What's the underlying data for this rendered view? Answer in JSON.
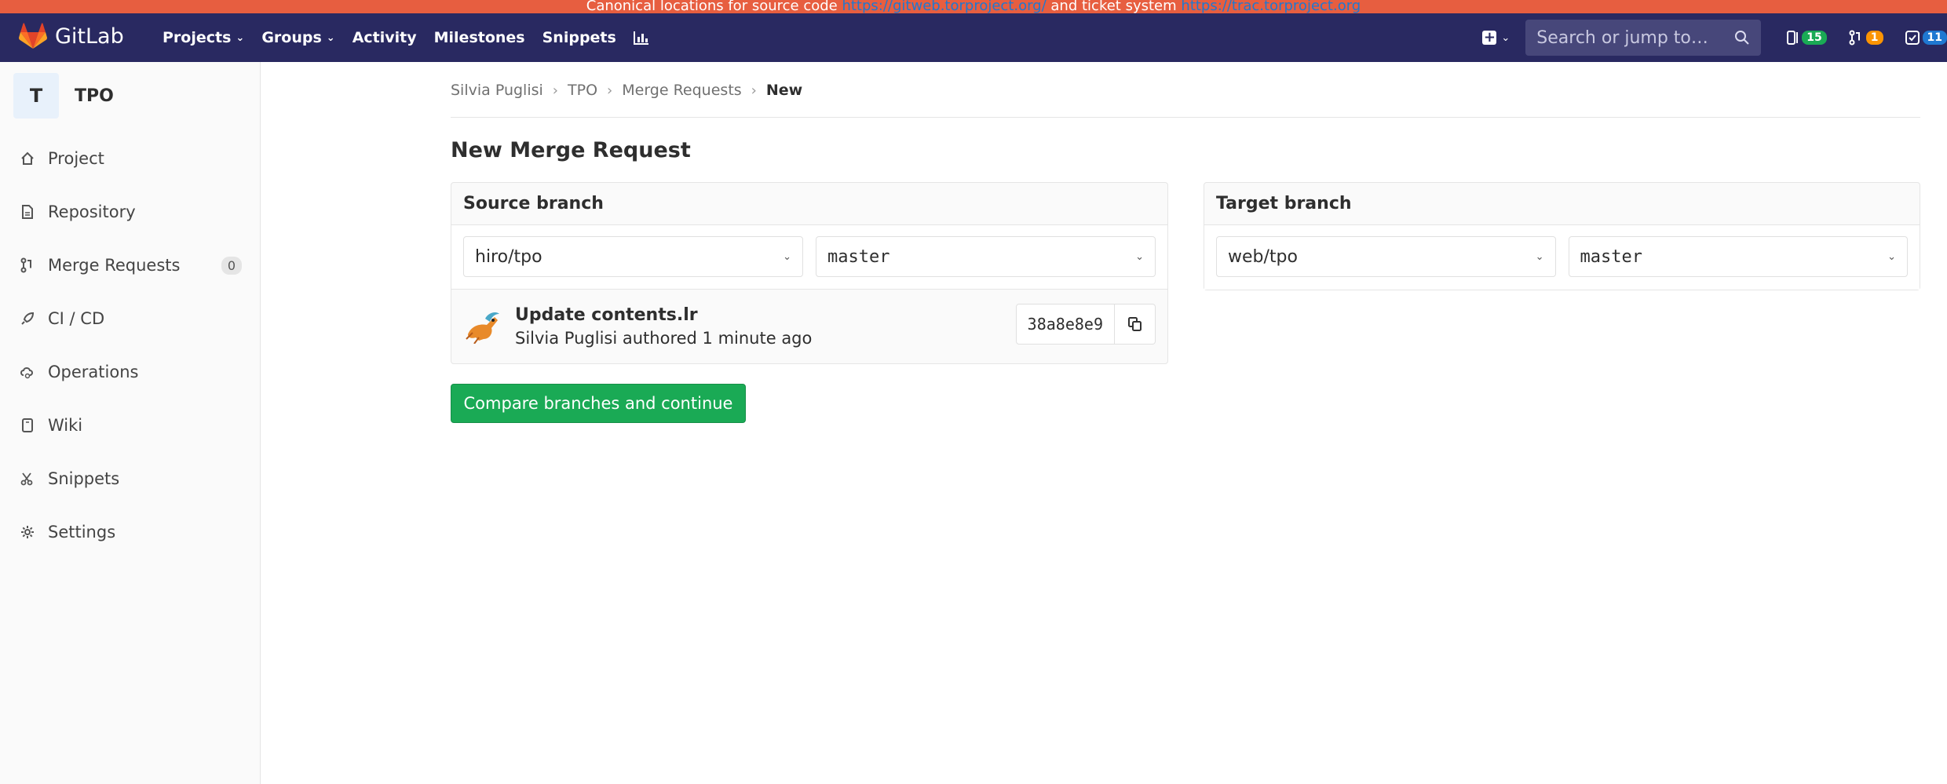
{
  "banner": {
    "text_before": "Canonical locations for source code",
    "link1": "https://gitweb.torproject.org/",
    "text_middle": "and ticket system",
    "link2": "https://trac.torproject.org"
  },
  "navbar": {
    "brand": "GitLab",
    "links": [
      {
        "label": "Projects",
        "dropdown": true
      },
      {
        "label": "Groups",
        "dropdown": true
      },
      {
        "label": "Activity",
        "dropdown": false
      },
      {
        "label": "Milestones",
        "dropdown": false
      },
      {
        "label": "Snippets",
        "dropdown": false
      }
    ],
    "chart_icon": "chart-icon",
    "search_placeholder": "Search or jump to…",
    "counts": {
      "issues": "15",
      "merge_requests": "1",
      "todos": "11"
    }
  },
  "sidebar": {
    "project_initial": "T",
    "project_name": "TPO",
    "items": [
      {
        "label": "Project",
        "icon": "home-icon"
      },
      {
        "label": "Repository",
        "icon": "doc-icon"
      },
      {
        "label": "Merge Requests",
        "icon": "merge-request-icon",
        "count": "0"
      },
      {
        "label": "CI / CD",
        "icon": "rocket-icon"
      },
      {
        "label": "Operations",
        "icon": "cloud-gear-icon"
      },
      {
        "label": "Wiki",
        "icon": "book-icon"
      },
      {
        "label": "Snippets",
        "icon": "scissors-icon"
      },
      {
        "label": "Settings",
        "icon": "gear-icon"
      }
    ]
  },
  "breadcrumb": [
    "Silvia Puglisi",
    "TPO",
    "Merge Requests",
    "New"
  ],
  "page_title": "New Merge Request",
  "source": {
    "title": "Source branch",
    "project": "hiro/tpo",
    "branch": "master",
    "commit_title": "Update contents.lr",
    "commit_author": "Silvia Puglisi",
    "commit_meta": "authored 1 minute ago",
    "sha": "38a8e8e9"
  },
  "target": {
    "title": "Target branch",
    "project": "web/tpo",
    "branch": "master"
  },
  "compare_button": "Compare branches and continue",
  "colors": {
    "banner": "#e75e40",
    "navbar": "#292961",
    "accent_green": "#1aaa55"
  }
}
